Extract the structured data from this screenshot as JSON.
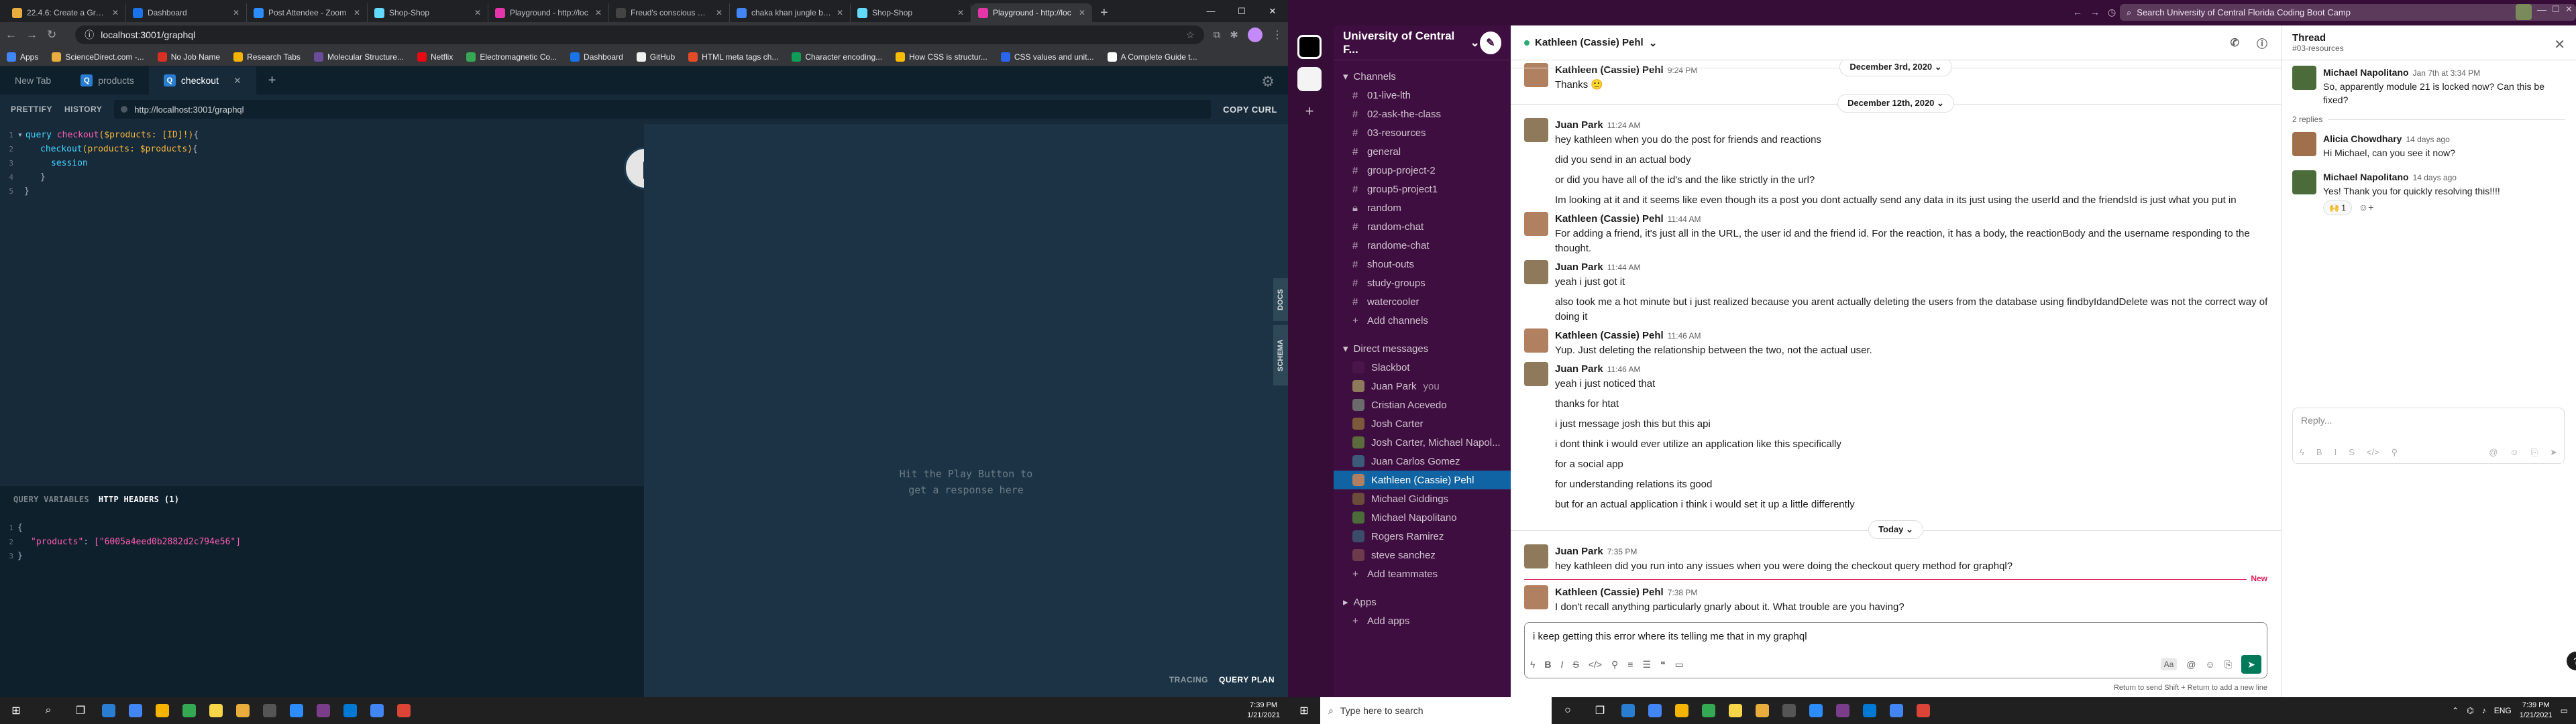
{
  "left": {
    "chrome_tabs": [
      {
        "title": "22.4.6: Create a GraphQL",
        "color": "#e8ad3c"
      },
      {
        "title": "Dashboard",
        "color": "#1a73e8"
      },
      {
        "title": "Post Attendee - Zoom",
        "color": "#2d8cff"
      },
      {
        "title": "Shop-Shop",
        "color": "#61dafb"
      },
      {
        "title": "Playground - http://loc",
        "color": "#e535ab"
      },
      {
        "title": "Freud's conscious mind",
        "color": "#444444"
      },
      {
        "title": "chaka khan jungle boo",
        "color": "#4285f4"
      },
      {
        "title": "Shop-Shop",
        "color": "#61dafb"
      },
      {
        "title": "Playground - http://loc",
        "color": "#e535ab"
      }
    ],
    "active_tab": 8,
    "url": "localhost:3001/graphql",
    "bookmarks": [
      "Apps",
      "ScienceDirect.com -...",
      "No Job Name",
      "Research Tabs",
      "Molecular Structure...",
      "Netflix",
      "Electromagnetic Co...",
      "Dashboard",
      "GitHub",
      "HTML meta tags ch...",
      "Character encoding...",
      "How CSS is structur...",
      "CSS values and unit...",
      "A Complete Guide t..."
    ],
    "playground": {
      "tabs": [
        "New Tab",
        "products",
        "checkout"
      ],
      "active_tab": 2,
      "prettify": "PRETTIFY",
      "history": "HISTORY",
      "endpoint": "http://localhost:3001/graphql",
      "copy_curl": "COPY CURL",
      "query": {
        "l1_kw": "query",
        "l1_name": "checkout",
        "l1_args": "($products: [ID]!)",
        "l1_brace": " {",
        "l2_field": "checkout",
        "l2_args": "(products: $products)",
        "l2_brace": " {",
        "l3_field": "session",
        "l4": "}",
        "l5": "}"
      },
      "line_numbers": [
        "1",
        "2",
        "3",
        "4",
        "5"
      ],
      "result_hint_1": "Hit the Play Button to",
      "result_hint_2": "get a response here",
      "docs": "DOCS",
      "schema": "SCHEMA",
      "query_variables": "QUERY VARIABLES",
      "http_headers": "HTTP HEADERS (1)",
      "variables": {
        "open": "{",
        "key": "\"products\"",
        "value": "[\"6005a4eed0b2882d2c794e56\"]",
        "close": "}"
      },
      "tracing": "TRACING",
      "query_plan": "QUERY PLAN"
    },
    "taskbar": {
      "search_placeholder": "Type here to search",
      "time": "7:39 PM",
      "date": "1/21/2021"
    }
  },
  "right": {
    "search_placeholder": "Search University of Central Florida Coding Boot Camp",
    "workspace": "University of Central F...",
    "sections": {
      "channels_label": "Channels",
      "dms_label": "Direct messages",
      "apps_label": "Apps"
    },
    "channels": [
      "01-live-lth",
      "02-ask-the-class",
      "03-resources",
      "general",
      "group-project-2",
      "group5-project1",
      "random",
      "random-chat",
      "randome-chat",
      "shout-outs",
      "study-groups",
      "watercooler"
    ],
    "add_channels": "Add channels",
    "dms": [
      {
        "name": "Slackbot",
        "color": "#4a154b",
        "you": ""
      },
      {
        "name": "Juan Park",
        "color": "#8e7a5b",
        "you": "you"
      },
      {
        "name": "Cristian Acevedo",
        "color": "#6b6b6b",
        "you": ""
      },
      {
        "name": "Josh Carter",
        "color": "#7b5a3c",
        "you": ""
      },
      {
        "name": "Josh Carter, Michael Napol...",
        "color": "#5b6b3c",
        "you": ""
      },
      {
        "name": "Juan Carlos Gomez",
        "color": "#3c5b7b",
        "you": ""
      },
      {
        "name": "Kathleen (Cassie) Pehl",
        "color": "#b08060",
        "you": ""
      },
      {
        "name": "Michael Giddings",
        "color": "#6b4c3b",
        "you": ""
      },
      {
        "name": "Michael Napolitano",
        "color": "#4c6b3b",
        "you": ""
      },
      {
        "name": "Rogers Ramirez",
        "color": "#3b4c6b",
        "you": ""
      },
      {
        "name": "steve sanchez",
        "color": "#6b3b4c",
        "you": ""
      }
    ],
    "selected_dm": 6,
    "add_teammates": "Add teammates",
    "add_apps": "Add apps",
    "channel_title": "Kathleen (Cassie) Pehl",
    "messages_top": {
      "who": "Kathleen (Cassie) Pehl",
      "time": "9:24 PM",
      "text": "Thanks 🙂"
    },
    "date_dec3": "December 3rd, 2020 ⌄",
    "date_dec12": "December 12th, 2020 ⌄",
    "thread_a": {
      "who": "Juan Park",
      "time": "11:24 AM",
      "lines": [
        "hey kathleen when you do the post for friends and reactions",
        "did you send in an actual body",
        "or did you have all of the id's and the like strictly in the url?",
        "Im looking at it and it seems like even though its a post you dont actually send any data in its just using the userId and the friendsId is just what you put in"
      ]
    },
    "thread_b": {
      "who": "Kathleen (Cassie) Pehl",
      "time": "11:44 AM",
      "text": "For adding a friend, it's just all in the URL, the user id and the friend id. For the reaction, it has a body, the reactionBody and the username responding to the thought."
    },
    "thread_c": {
      "who": "Juan Park",
      "time": "11:44 AM",
      "lines": [
        "yeah i just got it",
        "also took me a hot minute but i just realized because you arent actually deleting the users from the database using findbyIdandDelete was not the correct way of doing it"
      ]
    },
    "thread_d": {
      "who": "Kathleen (Cassie) Pehl",
      "time": "11:46 AM",
      "text": "Yup.  Just deleting the relationship between the two, not the actual user."
    },
    "thread_e": {
      "who": "Juan Park",
      "time": "11:46 AM",
      "lines": [
        "yeah i just noticed that",
        "thanks for htat",
        "i just message josh this but this api",
        "i dont think i would ever utilize an application like this specifically",
        "for a social app",
        "for understanding relations its good",
        "but for an actual application i think i would set it up a little differently"
      ]
    },
    "date_today": "Today ⌄",
    "thread_f": {
      "who": "Juan Park",
      "time": "7:35 PM",
      "text": "hey kathleen did you run into any issues when you were doing the checkout query method for graphql?"
    },
    "new_label": "New",
    "thread_g": {
      "who": "Kathleen (Cassie) Pehl",
      "time": "7:38 PM",
      "text": "I don't recall anything particularly gnarly about it.  What trouble are you having?"
    },
    "composer_text": "i keep getting this error where its telling me that in my graphql",
    "composer_hint": "Return to send   Shift + Return to add a new line",
    "thread_panel": {
      "title": "Thread",
      "channel": "#03-resources",
      "parent": {
        "who": "Michael Napolitano",
        "time": "Jan 7th at 3:34 PM",
        "text": "So, apparently module 21 is locked now? Can this be fixed?"
      },
      "replies": "2 replies",
      "reply1": {
        "who": "Alicia Chowdhary",
        "time": "14 days ago",
        "text": "Hi Michael, can you see it now?"
      },
      "reply2": {
        "who": "Michael Napolitano",
        "time": "14 days ago",
        "text": "Yes! Thank you for quickly resolving this!!!!",
        "reaction": "🙌 1"
      },
      "reply_placeholder": "Reply..."
    },
    "taskbar": {
      "search_placeholder": "Type here to search",
      "time": "7:39 PM",
      "date": "1/21/2021",
      "lang": "ENG"
    }
  }
}
